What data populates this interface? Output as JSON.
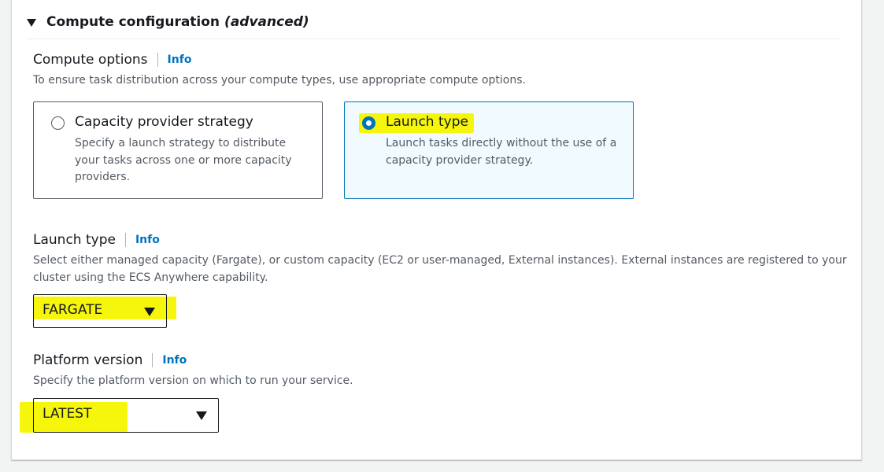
{
  "section": {
    "title": "Compute configuration",
    "title_suffix": "(advanced)"
  },
  "compute_options": {
    "label": "Compute options",
    "info": "Info",
    "description": "To ensure task distribution across your compute types, use appropriate compute options.",
    "tiles": [
      {
        "title": "Capacity provider strategy",
        "description": "Specify a launch strategy to distribute your tasks across one or more capacity providers.",
        "selected": false
      },
      {
        "title": "Launch type",
        "description": "Launch tasks directly without the use of a capacity provider strategy.",
        "selected": true
      }
    ]
  },
  "launch_type": {
    "label": "Launch type",
    "info": "Info",
    "description": "Select either managed capacity (Fargate), or custom capacity (EC2 or user-managed, External instances). External instances are registered to your cluster using the ECS Anywhere capability.",
    "selected_value": "FARGATE"
  },
  "platform_version": {
    "label": "Platform version",
    "info": "Info",
    "description": "Specify the platform version on which to run your service.",
    "selected_value": "LATEST"
  },
  "colors": {
    "link": "#0073bb",
    "selected_border": "#0073bb",
    "selected_bg": "#f1faff",
    "highlight": "#f5f500"
  },
  "icons": {
    "expand": "caret-down-icon",
    "radio_unchecked": "radio-unchecked-icon",
    "radio_checked": "radio-checked-icon",
    "select": "caret-down-icon"
  }
}
